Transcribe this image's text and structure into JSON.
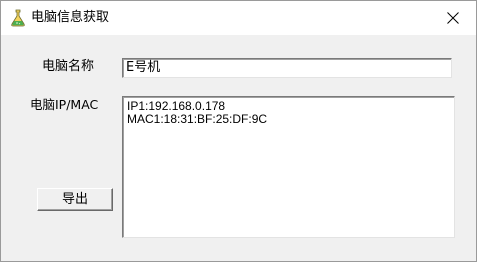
{
  "window": {
    "title": "电脑信息获取",
    "app_icon": "flask-icon",
    "close_icon": "close-icon"
  },
  "form": {
    "name_label": "电脑名称",
    "name_value": "E号机",
    "ipmac_label": "电脑IP/MAC",
    "info_lines": [
      "IP1:192.168.0.178",
      "MAC1:18:31:BF:25:DF:9C"
    ],
    "export_button": "导出"
  },
  "colors": {
    "background": "#f0f0f0",
    "titlebar": "#ffffff",
    "border": "#7a7a7a"
  }
}
